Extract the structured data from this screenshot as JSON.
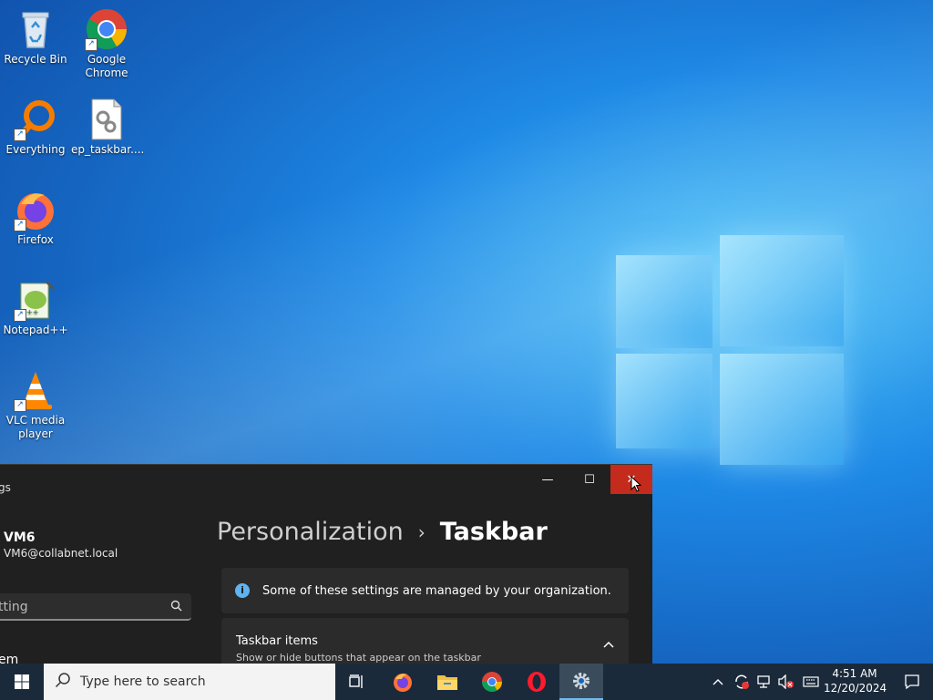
{
  "desktop": {
    "icons": [
      {
        "label": "Recycle Bin",
        "icon": "recycle-bin-icon"
      },
      {
        "label": "Google Chrome",
        "icon": "chrome-icon"
      },
      {
        "label": "Everything",
        "icon": "everything-search-icon"
      },
      {
        "label": "ep_taskbar....",
        "icon": "settings-file-icon"
      },
      {
        "label": "Firefox",
        "icon": "firefox-icon"
      },
      {
        "label": "Notepad++",
        "icon": "notepad-plus-plus-icon"
      },
      {
        "label": "VLC media player",
        "icon": "vlc-cone-icon"
      }
    ]
  },
  "settings_window": {
    "title_partial": "gs",
    "user": {
      "name": "VM6",
      "email": "VM6@collabnet.local"
    },
    "search_placeholder": "tting",
    "nav_partial": "em",
    "breadcrumb": {
      "parent": "Personalization",
      "separator": "›",
      "current": "Taskbar"
    },
    "notice": "Some of these settings are managed by your organization.",
    "section": {
      "title": "Taskbar items",
      "subtitle": "Show or hide buttons that appear on the taskbar"
    },
    "controls": {
      "minimize": "—",
      "maximize": "☐",
      "close": "✕"
    }
  },
  "taskbar": {
    "search_placeholder": "Type here to search",
    "apps": [
      "task-view-icon",
      "firefox-icon",
      "file-explorer-icon",
      "chrome-icon",
      "opera-icon",
      "settings-gear-icon"
    ],
    "clock": {
      "time": "4:51 AM",
      "date": "12/20/2024"
    }
  },
  "colors": {
    "close_red": "#c42b1c",
    "accent": "#76b9ed",
    "window_bg": "#202020"
  }
}
